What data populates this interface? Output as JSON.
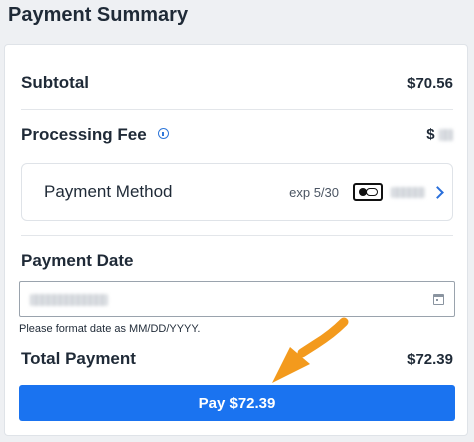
{
  "page_title": "Payment Summary",
  "subtotal": {
    "label": "Subtotal",
    "value": "$70.56"
  },
  "processing_fee": {
    "label": "Processing Fee",
    "value_prefix": "$"
  },
  "payment_method": {
    "label": "Payment Method",
    "expiration": "exp 5/30"
  },
  "payment_date": {
    "label": "Payment Date",
    "hint": "Please format date as MM/DD/YYYY."
  },
  "total_payment": {
    "label": "Total Payment",
    "value": "$72.39"
  },
  "pay_button": {
    "label": "Pay $72.39"
  },
  "colors": {
    "accent_blue": "#1a73f0",
    "arrow_orange": "#f39a1d"
  }
}
